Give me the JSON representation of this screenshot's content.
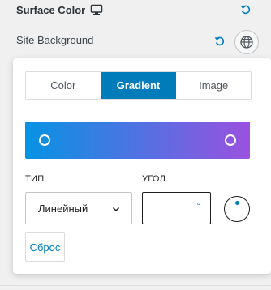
{
  "section": {
    "title": "Surface Color",
    "title_icon": "desktop-icon",
    "subsection_label": "Site Background"
  },
  "colors": {
    "accent": "#007cba",
    "gradient_start": "#0693e3",
    "gradient_end": "#9b51e0"
  },
  "tabs": [
    {
      "label": "Color",
      "active": false
    },
    {
      "label": "Gradient",
      "active": true
    },
    {
      "label": "Image",
      "active": false
    }
  ],
  "gradient": {
    "type_label": "ТИП",
    "type_value": "Линейный",
    "angle_label": "УГОЛ",
    "angle_value": "",
    "angle_unit": "°",
    "reset_label": "Сброс"
  }
}
